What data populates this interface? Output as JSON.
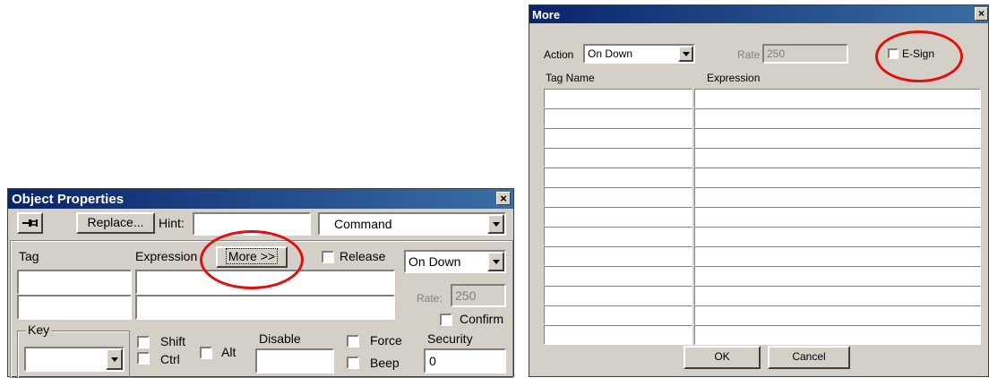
{
  "object_properties": {
    "title": "Object Properties",
    "close_glyph": "×",
    "pin_icon": "pin-icon",
    "replace_label": "Replace...",
    "hint_label": "Hint:",
    "hint_value": "",
    "type_value": "Command",
    "tag_label": "Tag",
    "expression_label": "Expression",
    "more_label": "More >>",
    "release_label": "Release",
    "action_value": "On Down",
    "rate_label": "Rate:",
    "rate_value": "250",
    "confirm_label": "Confirm",
    "key_label": "Key",
    "key_value": "",
    "shift_label": "Shift",
    "ctrl_label": "Ctrl",
    "alt_label": "Alt",
    "disable_label": "Disable",
    "disable_value": "",
    "force_label": "Force",
    "beep_label": "Beep",
    "security_label": "Security",
    "security_value": "0"
  },
  "more_dialog": {
    "title": "More",
    "close_glyph": "×",
    "action_label": "Action",
    "action_value": "On Down",
    "rate_label": "Rate",
    "rate_value": "250",
    "esign_label": "E-Sign",
    "tag_name_header": "Tag Name",
    "expression_header": "Expression",
    "rows": [
      "",
      "",
      "",
      "",
      "",
      "",
      "",
      "",
      "",
      "",
      "",
      "",
      ""
    ],
    "ok_label": "OK",
    "cancel_label": "Cancel"
  },
  "colors": {
    "highlight_circle": "#e01010",
    "title_gradient_start": "#0a246a",
    "title_gradient_end": "#3a6ea5",
    "dialog_face": "#d4d0c8"
  }
}
